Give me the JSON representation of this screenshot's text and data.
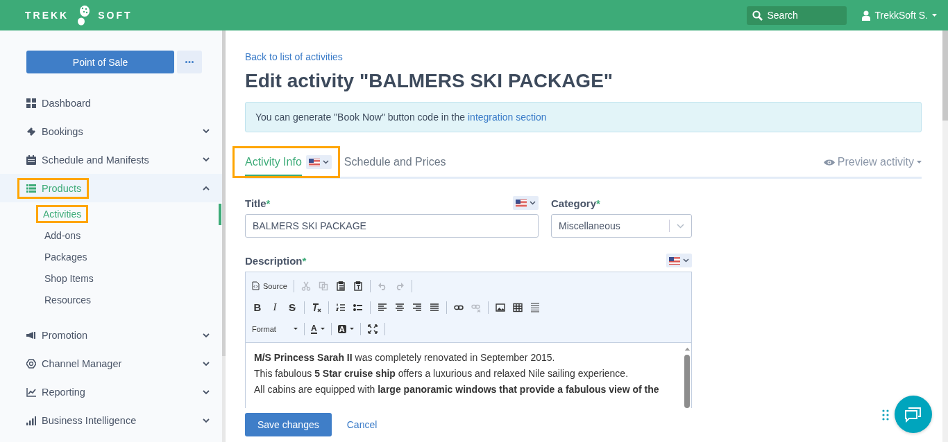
{
  "header": {
    "logo_left": "TREKK",
    "logo_right": "SOFT",
    "search": {
      "placeholder": "Search"
    },
    "user": "TrekkSoft S."
  },
  "sidebar": {
    "pos_button": "Point of Sale",
    "items": [
      {
        "label": "Dashboard",
        "kind": "link",
        "selected": false,
        "highlighted": false
      },
      {
        "label": "Bookings",
        "kind": "group",
        "expanded": false,
        "selected": false,
        "highlighted": false
      },
      {
        "label": "Schedule and Manifests",
        "kind": "group",
        "expanded": false,
        "selected": false,
        "highlighted": false
      },
      {
        "label": "Products",
        "kind": "group",
        "expanded": true,
        "selected": true,
        "highlighted": true,
        "children": [
          {
            "label": "Activities",
            "selected": true,
            "highlighted": true
          },
          {
            "label": "Add-ons",
            "selected": false,
            "highlighted": false
          },
          {
            "label": "Packages",
            "selected": false,
            "highlighted": false
          },
          {
            "label": "Shop Items",
            "selected": false,
            "highlighted": false
          },
          {
            "label": "Resources",
            "selected": false,
            "highlighted": false
          }
        ]
      },
      {
        "label": "Promotion",
        "kind": "group",
        "expanded": false,
        "selected": false,
        "highlighted": false
      },
      {
        "label": "Channel Manager",
        "kind": "group",
        "expanded": false,
        "selected": false,
        "highlighted": false
      },
      {
        "label": "Reporting",
        "kind": "group",
        "expanded": false,
        "selected": false,
        "highlighted": false
      },
      {
        "label": "Business Intelligence",
        "kind": "group",
        "expanded": false,
        "selected": false,
        "highlighted": false
      }
    ]
  },
  "main": {
    "back_link": "Back to list of activities",
    "heading": "Edit activity \"BALMERS SKI PACKAGE\"",
    "alert": {
      "text": "You can generate \"Book Now\" button code in the",
      "link": "integration section"
    },
    "tabs": [
      {
        "label": "Activity Info",
        "selected": true,
        "highlighted": true,
        "language_menu": true
      },
      {
        "label": "Schedule and Prices",
        "selected": false,
        "highlighted": false,
        "language_menu": false
      }
    ],
    "preview": "Preview activity",
    "title_field": {
      "label": "Title",
      "required_mark": "*",
      "value": "BALMERS SKI PACKAGE",
      "language_menu": true
    },
    "category_field": {
      "label": "Category",
      "required_mark": "*",
      "value": "Miscellaneous"
    },
    "description": {
      "label": "Description",
      "required_mark": "*",
      "language_menu": true,
      "toolbar": [
        [
          {
            "kind": "source",
            "label": "Source",
            "group_end": true
          },
          {
            "kind": "icon",
            "disabled": true
          },
          {
            "kind": "icon",
            "disabled": true
          },
          {
            "kind": "icon",
            "disabled": false
          },
          {
            "kind": "icon",
            "disabled": false,
            "group_end": true
          },
          {
            "kind": "icon",
            "disabled": true
          },
          {
            "kind": "icon",
            "disabled": true,
            "group_end": true
          }
        ],
        [
          {
            "kind": "letter",
            "label": "B"
          },
          {
            "kind": "letter",
            "label": "I"
          },
          {
            "kind": "letter",
            "label": "S",
            "group_end": true
          },
          {
            "kind": "icon",
            "disabled": false,
            "group_end": true
          },
          {
            "kind": "icon",
            "disabled": false
          },
          {
            "kind": "icon",
            "disabled": false,
            "group_end": true
          },
          {
            "kind": "icon",
            "disabled": false
          },
          {
            "kind": "icon",
            "disabled": false
          },
          {
            "kind": "icon",
            "disabled": false
          },
          {
            "kind": "icon",
            "disabled": false,
            "group_end": true
          },
          {
            "kind": "icon",
            "disabled": false
          },
          {
            "kind": "icon",
            "disabled": true,
            "group_end": true
          },
          {
            "kind": "icon",
            "disabled": false
          },
          {
            "kind": "icon",
            "disabled": false
          },
          {
            "kind": "icon",
            "disabled": false
          }
        ],
        [
          {
            "kind": "menu",
            "label": "Format",
            "group_end": true
          },
          {
            "kind": "text-color",
            "label": "A",
            "group_end": true
          },
          {
            "kind": "background-color",
            "label": "A",
            "group_end": true
          },
          {
            "kind": "icon",
            "disabled": false,
            "group_end": true
          }
        ]
      ],
      "paragraphs": [
        "**M/S Princess Sarah II** was completely renovated in September 2015.",
        "This fabulous **5 Star cruise ship** offers a luxurious and relaxed Nile sailing experience.",
        "All cabins are equipped with **large panoramic windows that provide a fabulous view of the**"
      ]
    },
    "save_button": "Save changes",
    "cancel_link": "Cancel"
  }
}
